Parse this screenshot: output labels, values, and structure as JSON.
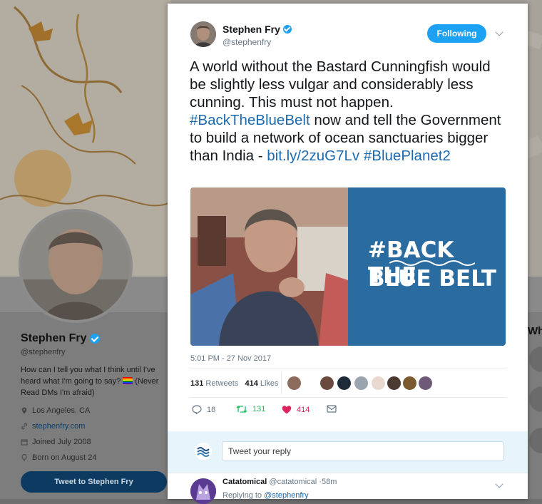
{
  "profile": {
    "name": "Stephen Fry",
    "handle": "@stephenfry",
    "bio": "How can I tell you what I think until I've heard what I'm going to say?",
    "bio_tail": "(Never Read DMs I'm afraid)",
    "location": "Los Angeles, CA",
    "website": "stephenfry.com",
    "joined": "Joined July 2008",
    "born": "Born on August 24",
    "tweet_to_label": "Tweet to Stephen Fry",
    "who_peek": "Wh"
  },
  "tweet": {
    "author_name": "Stephen Fry",
    "author_handle": "@stephenfry",
    "follow_label": "Following",
    "text_1": "A world without the Bastard Cunningfish would be slightly less vulgar and considerably less cunning. This must not happen.",
    "hashtag_1": "#BackTheBlueBelt",
    "text_2": "now and tell the Government to build a network of ocean sanctuaries bigger than India -",
    "link": "bit.ly/2zuG7Lv",
    "hashtag_2": "#BluePlanet2",
    "banner_line_1": "#BACK THE",
    "banner_line_2": "BLUE BELT",
    "timestamp": "5:01 PM - 27 Nov 2017",
    "retweets_count": "131",
    "retweets_label": "Retweets",
    "likes_count": "414",
    "likes_label": "Likes",
    "actions": {
      "reply_count": "18",
      "retweet_count": "131",
      "like_count": "414"
    },
    "colors": {
      "accent": "#1da1f2",
      "retweet": "#17bf63",
      "like": "#e0245e",
      "banner": "#2a6ca0"
    }
  },
  "compose": {
    "placeholder": "Tweet your reply"
  },
  "reply": {
    "name": "Catatomical",
    "handle": "@catatomical",
    "age": "58m",
    "replying_label": "Replying to",
    "replying_to": "@stephenfry"
  }
}
